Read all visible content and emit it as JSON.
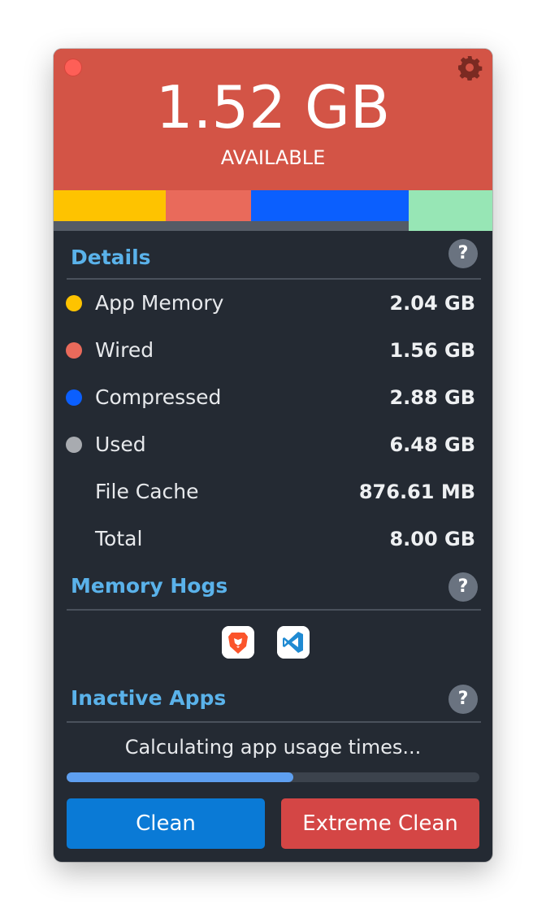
{
  "header": {
    "available_value": "1.52 GB",
    "available_label": "AVAILABLE",
    "close_icon": "close-icon",
    "settings_icon": "gear-icon",
    "color": "#d35446"
  },
  "memory_bar": {
    "segments": [
      {
        "name": "App Memory",
        "value_gb": 2.04,
        "color": "#fec300"
      },
      {
        "name": "Wired",
        "value_gb": 1.56,
        "color": "#e96a5b"
      },
      {
        "name": "Compressed",
        "value_gb": 2.88,
        "color": "#0b5ffe"
      },
      {
        "name": "Available",
        "value_gb": 1.52,
        "color": "#97e6b5"
      }
    ],
    "used_fraction": 0.81
  },
  "details": {
    "title": "Details",
    "help": "?",
    "rows": [
      {
        "label": "App Memory",
        "value": "2.04 GB",
        "color": "#fec300"
      },
      {
        "label": "Wired",
        "value": "1.56 GB",
        "color": "#e96a5b"
      },
      {
        "label": "Compressed",
        "value": "2.88 GB",
        "color": "#0b5ffe"
      },
      {
        "label": "Used",
        "value": "6.48 GB",
        "color": "#a8abb0"
      },
      {
        "label": "File Cache",
        "value": "876.61 MB"
      },
      {
        "label": "Total",
        "value": "8.00 GB"
      }
    ]
  },
  "memory_hogs": {
    "title": "Memory Hogs",
    "help": "?",
    "apps": [
      "brave-browser-icon",
      "vscode-icon"
    ]
  },
  "inactive_apps": {
    "title": "Inactive Apps",
    "help": "?",
    "status": "Calculating app usage times...",
    "progress": 0.55
  },
  "buttons": {
    "clean": "Clean",
    "extreme_clean": "Extreme Clean",
    "clean_color": "#0a7ad6",
    "extreme_color": "#d44645"
  }
}
